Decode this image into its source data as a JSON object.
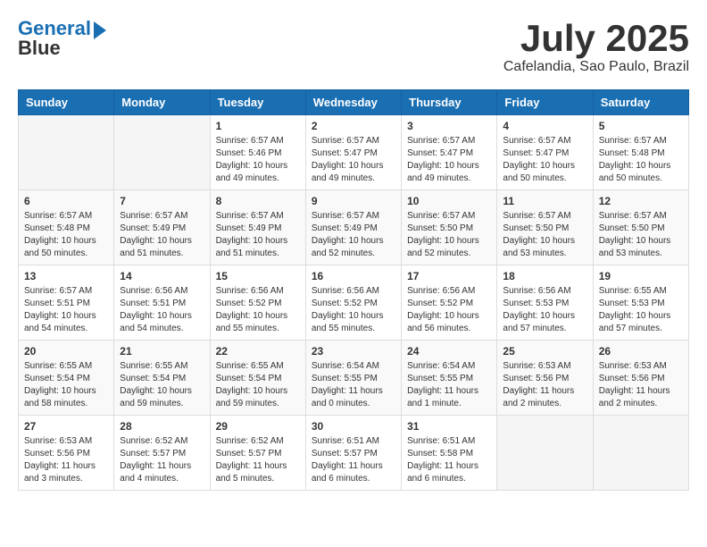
{
  "logo": {
    "line1": "General",
    "line2": "Blue"
  },
  "title": "July 2025",
  "location": "Cafelandia, Sao Paulo, Brazil",
  "weekdays": [
    "Sunday",
    "Monday",
    "Tuesday",
    "Wednesday",
    "Thursday",
    "Friday",
    "Saturday"
  ],
  "weeks": [
    [
      {
        "day": "",
        "sunrise": "",
        "sunset": "",
        "daylight": ""
      },
      {
        "day": "",
        "sunrise": "",
        "sunset": "",
        "daylight": ""
      },
      {
        "day": "1",
        "sunrise": "Sunrise: 6:57 AM",
        "sunset": "Sunset: 5:46 PM",
        "daylight": "Daylight: 10 hours and 49 minutes."
      },
      {
        "day": "2",
        "sunrise": "Sunrise: 6:57 AM",
        "sunset": "Sunset: 5:47 PM",
        "daylight": "Daylight: 10 hours and 49 minutes."
      },
      {
        "day": "3",
        "sunrise": "Sunrise: 6:57 AM",
        "sunset": "Sunset: 5:47 PM",
        "daylight": "Daylight: 10 hours and 49 minutes."
      },
      {
        "day": "4",
        "sunrise": "Sunrise: 6:57 AM",
        "sunset": "Sunset: 5:47 PM",
        "daylight": "Daylight: 10 hours and 50 minutes."
      },
      {
        "day": "5",
        "sunrise": "Sunrise: 6:57 AM",
        "sunset": "Sunset: 5:48 PM",
        "daylight": "Daylight: 10 hours and 50 minutes."
      }
    ],
    [
      {
        "day": "6",
        "sunrise": "Sunrise: 6:57 AM",
        "sunset": "Sunset: 5:48 PM",
        "daylight": "Daylight: 10 hours and 50 minutes."
      },
      {
        "day": "7",
        "sunrise": "Sunrise: 6:57 AM",
        "sunset": "Sunset: 5:49 PM",
        "daylight": "Daylight: 10 hours and 51 minutes."
      },
      {
        "day": "8",
        "sunrise": "Sunrise: 6:57 AM",
        "sunset": "Sunset: 5:49 PM",
        "daylight": "Daylight: 10 hours and 51 minutes."
      },
      {
        "day": "9",
        "sunrise": "Sunrise: 6:57 AM",
        "sunset": "Sunset: 5:49 PM",
        "daylight": "Daylight: 10 hours and 52 minutes."
      },
      {
        "day": "10",
        "sunrise": "Sunrise: 6:57 AM",
        "sunset": "Sunset: 5:50 PM",
        "daylight": "Daylight: 10 hours and 52 minutes."
      },
      {
        "day": "11",
        "sunrise": "Sunrise: 6:57 AM",
        "sunset": "Sunset: 5:50 PM",
        "daylight": "Daylight: 10 hours and 53 minutes."
      },
      {
        "day": "12",
        "sunrise": "Sunrise: 6:57 AM",
        "sunset": "Sunset: 5:50 PM",
        "daylight": "Daylight: 10 hours and 53 minutes."
      }
    ],
    [
      {
        "day": "13",
        "sunrise": "Sunrise: 6:57 AM",
        "sunset": "Sunset: 5:51 PM",
        "daylight": "Daylight: 10 hours and 54 minutes."
      },
      {
        "day": "14",
        "sunrise": "Sunrise: 6:56 AM",
        "sunset": "Sunset: 5:51 PM",
        "daylight": "Daylight: 10 hours and 54 minutes."
      },
      {
        "day": "15",
        "sunrise": "Sunrise: 6:56 AM",
        "sunset": "Sunset: 5:52 PM",
        "daylight": "Daylight: 10 hours and 55 minutes."
      },
      {
        "day": "16",
        "sunrise": "Sunrise: 6:56 AM",
        "sunset": "Sunset: 5:52 PM",
        "daylight": "Daylight: 10 hours and 55 minutes."
      },
      {
        "day": "17",
        "sunrise": "Sunrise: 6:56 AM",
        "sunset": "Sunset: 5:52 PM",
        "daylight": "Daylight: 10 hours and 56 minutes."
      },
      {
        "day": "18",
        "sunrise": "Sunrise: 6:56 AM",
        "sunset": "Sunset: 5:53 PM",
        "daylight": "Daylight: 10 hours and 57 minutes."
      },
      {
        "day": "19",
        "sunrise": "Sunrise: 6:55 AM",
        "sunset": "Sunset: 5:53 PM",
        "daylight": "Daylight: 10 hours and 57 minutes."
      }
    ],
    [
      {
        "day": "20",
        "sunrise": "Sunrise: 6:55 AM",
        "sunset": "Sunset: 5:54 PM",
        "daylight": "Daylight: 10 hours and 58 minutes."
      },
      {
        "day": "21",
        "sunrise": "Sunrise: 6:55 AM",
        "sunset": "Sunset: 5:54 PM",
        "daylight": "Daylight: 10 hours and 59 minutes."
      },
      {
        "day": "22",
        "sunrise": "Sunrise: 6:55 AM",
        "sunset": "Sunset: 5:54 PM",
        "daylight": "Daylight: 10 hours and 59 minutes."
      },
      {
        "day": "23",
        "sunrise": "Sunrise: 6:54 AM",
        "sunset": "Sunset: 5:55 PM",
        "daylight": "Daylight: 11 hours and 0 minutes."
      },
      {
        "day": "24",
        "sunrise": "Sunrise: 6:54 AM",
        "sunset": "Sunset: 5:55 PM",
        "daylight": "Daylight: 11 hours and 1 minute."
      },
      {
        "day": "25",
        "sunrise": "Sunrise: 6:53 AM",
        "sunset": "Sunset: 5:56 PM",
        "daylight": "Daylight: 11 hours and 2 minutes."
      },
      {
        "day": "26",
        "sunrise": "Sunrise: 6:53 AM",
        "sunset": "Sunset: 5:56 PM",
        "daylight": "Daylight: 11 hours and 2 minutes."
      }
    ],
    [
      {
        "day": "27",
        "sunrise": "Sunrise: 6:53 AM",
        "sunset": "Sunset: 5:56 PM",
        "daylight": "Daylight: 11 hours and 3 minutes."
      },
      {
        "day": "28",
        "sunrise": "Sunrise: 6:52 AM",
        "sunset": "Sunset: 5:57 PM",
        "daylight": "Daylight: 11 hours and 4 minutes."
      },
      {
        "day": "29",
        "sunrise": "Sunrise: 6:52 AM",
        "sunset": "Sunset: 5:57 PM",
        "daylight": "Daylight: 11 hours and 5 minutes."
      },
      {
        "day": "30",
        "sunrise": "Sunrise: 6:51 AM",
        "sunset": "Sunset: 5:57 PM",
        "daylight": "Daylight: 11 hours and 6 minutes."
      },
      {
        "day": "31",
        "sunrise": "Sunrise: 6:51 AM",
        "sunset": "Sunset: 5:58 PM",
        "daylight": "Daylight: 11 hours and 6 minutes."
      },
      {
        "day": "",
        "sunrise": "",
        "sunset": "",
        "daylight": ""
      },
      {
        "day": "",
        "sunrise": "",
        "sunset": "",
        "daylight": ""
      }
    ]
  ]
}
